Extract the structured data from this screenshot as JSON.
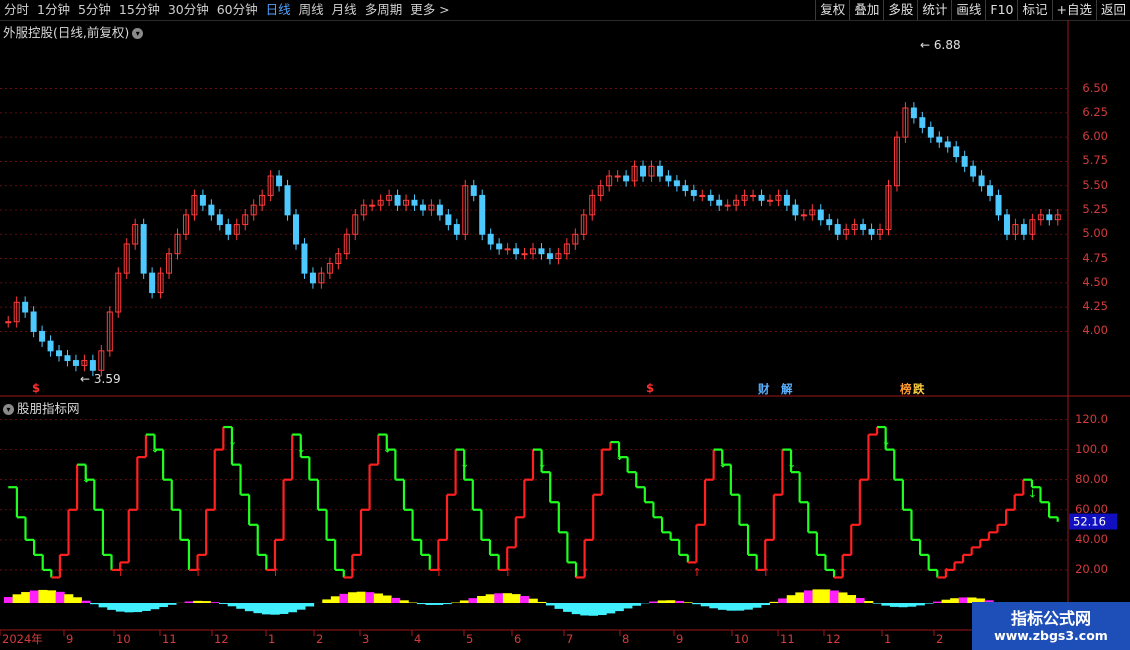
{
  "toolbar": {
    "tabs": [
      "分时",
      "1分钟",
      "5分钟",
      "15分钟",
      "30分钟",
      "60分钟",
      "日线",
      "周线",
      "月线",
      "多周期",
      "更多"
    ],
    "active_tab": "日线",
    "right_buttons": [
      "复权",
      "叠加",
      "多股",
      "统计",
      "画线",
      "F10",
      "标记",
      "+自选",
      "返回"
    ]
  },
  "main_pane": {
    "title": "外服控股(日线,前复权)",
    "y_ticks": [
      "6.50",
      "6.25",
      "6.00",
      "5.75",
      "5.50",
      "5.25",
      "5.00",
      "4.75",
      "4.50",
      "4.25",
      "4.00"
    ],
    "high_marker": "6.88",
    "low_marker": "3.59",
    "event_flags": [
      {
        "text": "$",
        "color": "#ff3030"
      },
      {
        "text": "$",
        "color": "#ff3030"
      },
      {
        "text": "财",
        "color": "#5ab0ff"
      },
      {
        "text": "解",
        "color": "#5ab0ff"
      },
      {
        "text": "榜",
        "color": "#ff9a30"
      },
      {
        "text": "跌",
        "color": "#ffd040"
      }
    ]
  },
  "indicator_pane": {
    "title": "股朋指标网",
    "y_ticks": [
      "120.0",
      "100.0",
      "80.00",
      "60.00",
      "40.00",
      "20.00"
    ],
    "current_value": "52.16"
  },
  "x_axis": {
    "labels": [
      "2024年",
      "9",
      "10",
      "11",
      "12",
      "1",
      "2",
      "3",
      "4",
      "5",
      "6",
      "7",
      "8",
      "9",
      "10",
      "11",
      "12",
      "1",
      "2"
    ]
  },
  "watermark": {
    "line1": "指标公式网",
    "line2": "www.zbgs3.com"
  },
  "colors": {
    "up": "#ff3c3c",
    "down": "#4ec9ff",
    "osc_up": "#ff2020",
    "osc_down": "#20ff20",
    "histo_yellow": "#ffff00",
    "histo_magenta": "#ff20ff",
    "histo_cyan": "#40f0ff",
    "grid": "#7a1010"
  },
  "chart_data": {
    "type": "candlestick",
    "ylim": [
      3.5,
      7.0
    ],
    "closes": [
      4.1,
      4.3,
      4.2,
      4.0,
      3.9,
      3.8,
      3.75,
      3.7,
      3.65,
      3.7,
      3.6,
      3.8,
      4.2,
      4.6,
      4.9,
      5.1,
      4.6,
      4.4,
      4.6,
      4.8,
      5.0,
      5.2,
      5.4,
      5.3,
      5.2,
      5.1,
      5.0,
      5.1,
      5.2,
      5.3,
      5.4,
      5.6,
      5.5,
      5.2,
      4.9,
      4.6,
      4.5,
      4.6,
      4.7,
      4.8,
      5.0,
      5.2,
      5.3,
      5.3,
      5.35,
      5.4,
      5.3,
      5.35,
      5.3,
      5.25,
      5.3,
      5.2,
      5.1,
      5.0,
      5.5,
      5.4,
      5.0,
      4.9,
      4.85,
      4.85,
      4.8,
      4.8,
      4.85,
      4.8,
      4.75,
      4.8,
      4.9,
      5.0,
      5.2,
      5.4,
      5.5,
      5.6,
      5.6,
      5.55,
      5.7,
      5.6,
      5.7,
      5.6,
      5.55,
      5.5,
      5.45,
      5.4,
      5.4,
      5.35,
      5.3,
      5.3,
      5.35,
      5.4,
      5.4,
      5.35,
      5.35,
      5.4,
      5.3,
      5.2,
      5.2,
      5.25,
      5.15,
      5.1,
      5.0,
      5.05,
      5.1,
      5.05,
      5.0,
      5.05,
      5.5,
      6.0,
      6.3,
      6.2,
      6.1,
      6.0,
      5.95,
      5.9,
      5.8,
      5.7,
      5.6,
      5.5,
      5.4,
      5.2,
      5.0,
      5.1,
      5.0,
      5.15,
      5.2,
      5.15,
      5.2
    ],
    "oscillator": [
      75,
      55,
      40,
      30,
      20,
      15,
      30,
      60,
      90,
      80,
      60,
      30,
      20,
      25,
      60,
      95,
      110,
      100,
      80,
      60,
      40,
      20,
      30,
      60,
      100,
      115,
      90,
      70,
      50,
      30,
      20,
      40,
      80,
      110,
      95,
      80,
      60,
      40,
      20,
      15,
      30,
      60,
      90,
      110,
      100,
      80,
      60,
      40,
      30,
      20,
      40,
      70,
      100,
      80,
      60,
      40,
      30,
      20,
      35,
      55,
      80,
      100,
      85,
      65,
      45,
      25,
      15,
      40,
      70,
      100,
      105,
      95,
      85,
      75,
      65,
      55,
      45,
      40,
      30,
      25,
      50,
      80,
      100,
      90,
      70,
      50,
      30,
      20,
      40,
      70,
      100,
      85,
      65,
      45,
      30,
      20,
      15,
      30,
      50,
      80,
      110,
      115,
      100,
      80,
      60,
      40,
      30,
      20,
      15,
      20,
      25,
      30,
      35,
      40,
      45,
      50,
      60,
      70,
      80,
      75,
      65,
      55,
      52
    ],
    "x_labels": [
      "2024年",
      "9",
      "10",
      "11",
      "12",
      "1",
      "2",
      "3",
      "4",
      "5",
      "6",
      "7",
      "8",
      "9",
      "10",
      "11",
      "12",
      "1",
      "2"
    ]
  }
}
